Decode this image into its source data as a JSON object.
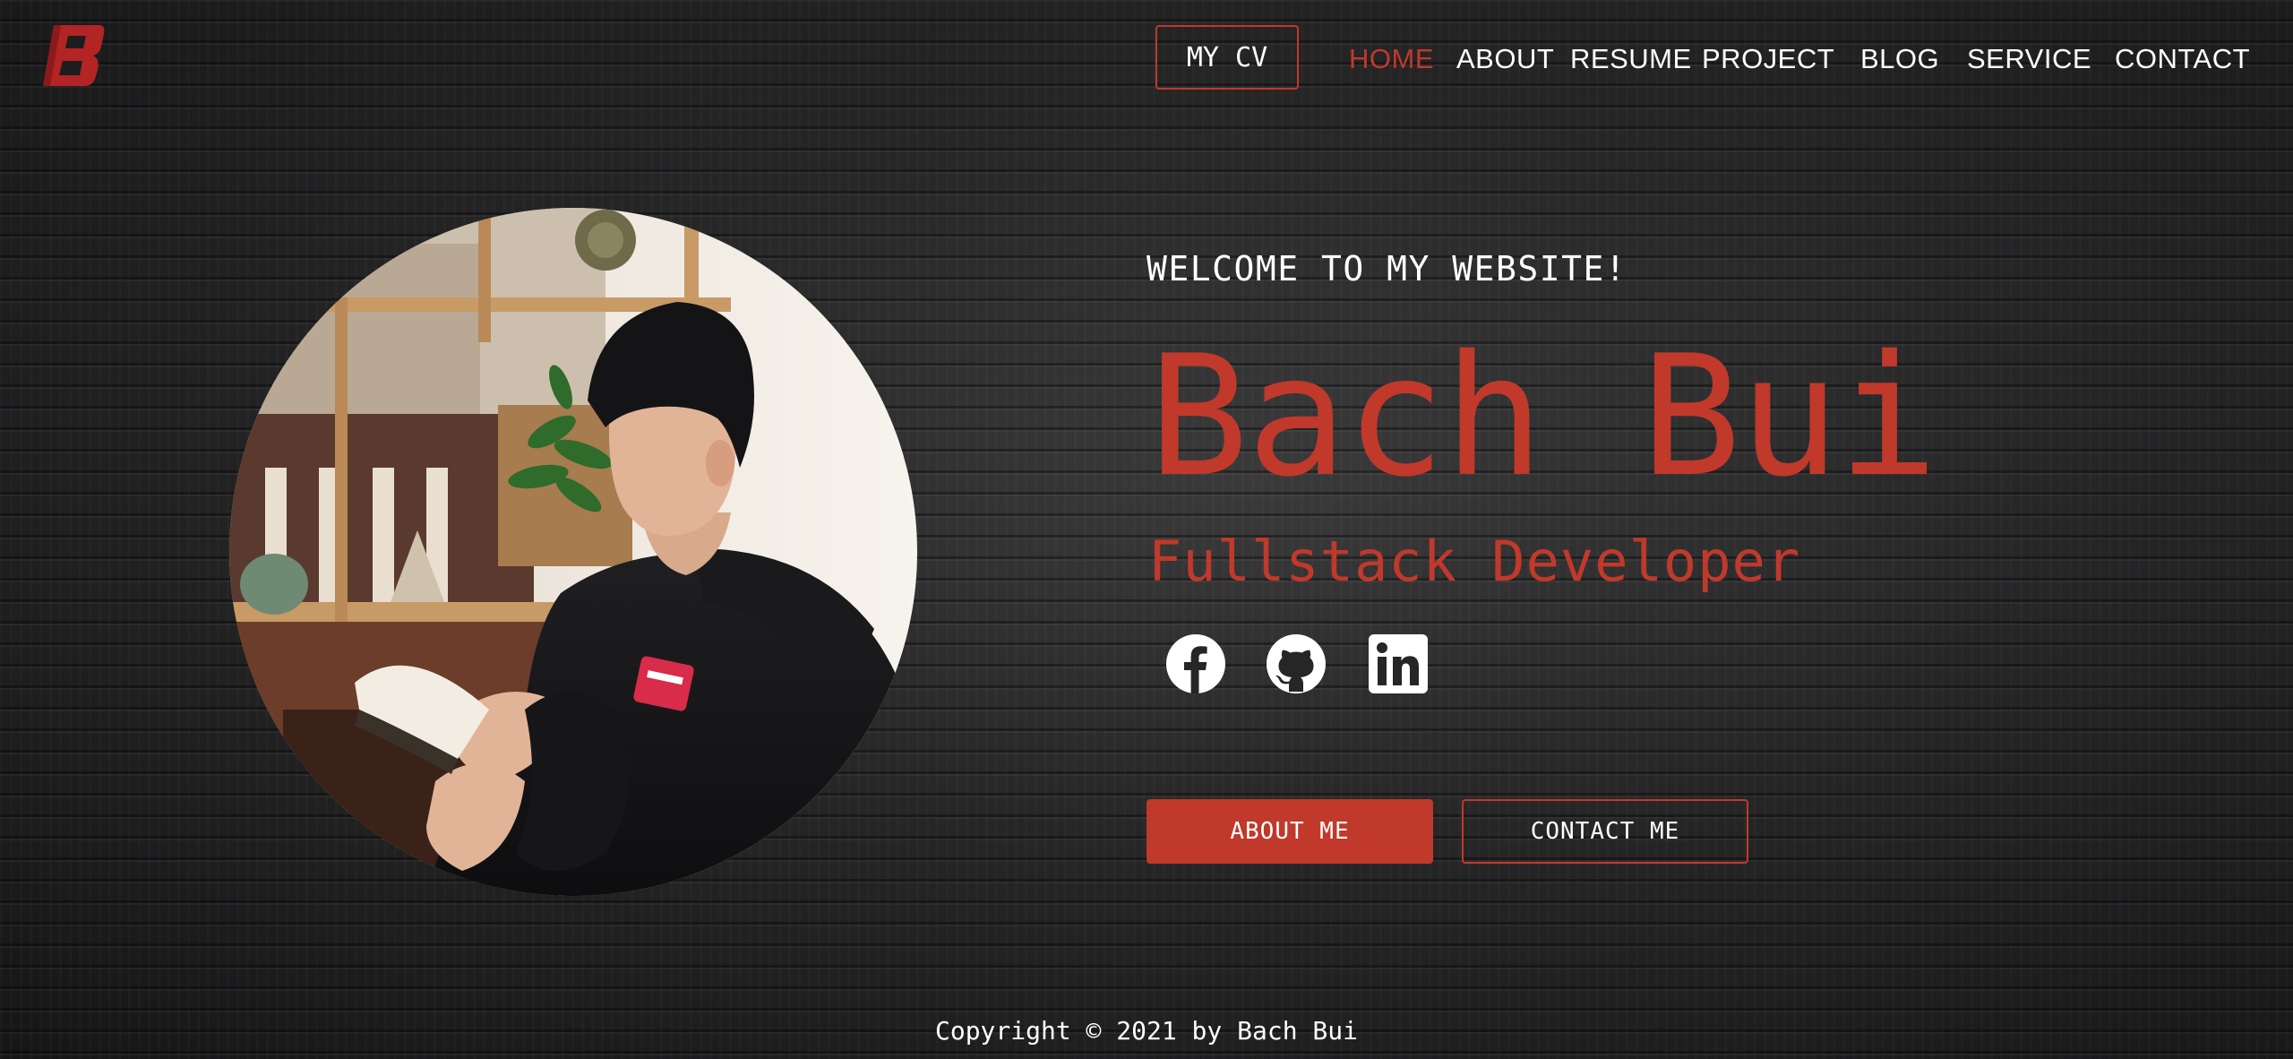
{
  "header": {
    "logo_icon": "brand-b-logo",
    "cv_label": "MY CV",
    "nav": [
      {
        "label": "HOME",
        "active": true
      },
      {
        "label": "ABOUT",
        "active": false
      },
      {
        "label": "RESUME",
        "active": false
      },
      {
        "label": "PROJECT",
        "active": false
      },
      {
        "label": "BLOG",
        "active": false
      },
      {
        "label": "SERVICE",
        "active": false
      },
      {
        "label": "CONTACT",
        "active": false
      }
    ]
  },
  "hero": {
    "welcome": "WELCOME TO MY WEBSITE!",
    "name": "Bach Bui",
    "role": "Fullstack Developer",
    "portrait": "profile-photo",
    "socials": [
      "facebook-icon",
      "github-icon",
      "linkedin-icon"
    ],
    "about_button": "ABOUT ME",
    "contact_button": "CONTACT ME"
  },
  "footer": {
    "copyright": "Copyright © 2021 by Bach Bui"
  },
  "colors": {
    "accent": "#c0392b",
    "text": "#ffffff",
    "background": "#222223"
  }
}
